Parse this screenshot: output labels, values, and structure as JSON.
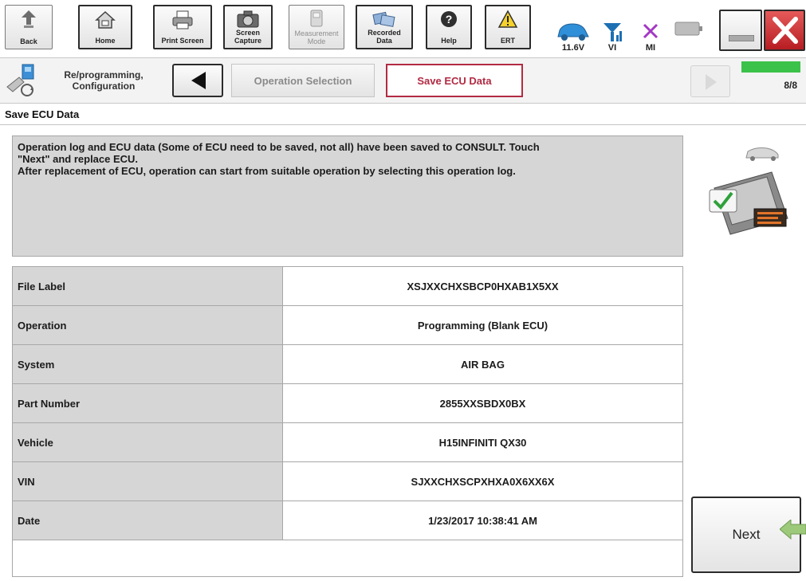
{
  "toolbar": {
    "back_label": "Back",
    "home_label": "Home",
    "print_label": "Print Screen",
    "capture_label": "Screen\nCapture",
    "measurement_label": "Measurement\nMode",
    "recorded_label": "Recorded\nData",
    "help_label": "Help",
    "ert_label": "ERT",
    "voltage": "11.6V",
    "vi_label": "VI",
    "mi_label": "MI"
  },
  "navbar": {
    "mode_label": "Re/programming,\nConfiguration",
    "step_prev": "Operation Selection",
    "step_current": "Save ECU Data",
    "progress_text": "8/8",
    "progress_fraction": 1.0
  },
  "page": {
    "title": "Save ECU Data",
    "message_lines": [
      "Operation log and ECU data (Some of ECU need to be saved, not all) have been saved to CONSULT. Touch",
      "\"Next\" and replace ECU.",
      "After replacement of ECU, operation can start from suitable operation by selecting this operation log."
    ]
  },
  "table": {
    "rows": [
      {
        "label": "File Label",
        "value": "XSJXXCHXSBCP0HXAB1X5XX"
      },
      {
        "label": "Operation",
        "value": "Programming (Blank ECU)"
      },
      {
        "label": "System",
        "value": "AIR BAG"
      },
      {
        "label": "Part Number",
        "value": "2855XXSBDX0BX"
      },
      {
        "label": "Vehicle",
        "value": "H15INFINITI QX30"
      },
      {
        "label": "VIN",
        "value": "SJXXCHXSCPXHXA0X6XX6X"
      },
      {
        "label": "Date",
        "value": "1/23/2017 10:38:41 AM"
      }
    ]
  },
  "next_label": "Next",
  "colors": {
    "active_step": "#b22a43",
    "progress": "#3bc24a",
    "close_button": "#d3363a",
    "panel_gray": "#d6d6d6"
  }
}
